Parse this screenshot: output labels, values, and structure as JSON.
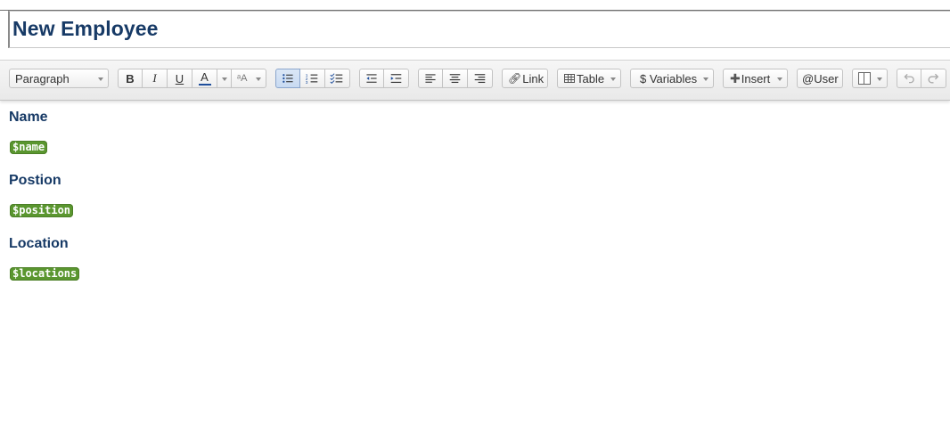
{
  "document": {
    "title": "New Employee"
  },
  "toolbar": {
    "paragraph_style": "Paragraph",
    "bold": "B",
    "italic": "I",
    "underline": "U",
    "text_color": "A",
    "link_label": "Link",
    "table_label": "Table",
    "variables_label": "$ Variables",
    "insert_label": "Insert",
    "user_label": "@User"
  },
  "content": {
    "sections": [
      {
        "label": "Name",
        "variable": "$name"
      },
      {
        "label": "Postion",
        "variable": "$position"
      },
      {
        "label": "Location",
        "variable": "$locations"
      }
    ]
  },
  "colors": {
    "heading": "#173a66",
    "variable_pill": "#5a962f",
    "text_color_underline": "#1f4f9c"
  }
}
